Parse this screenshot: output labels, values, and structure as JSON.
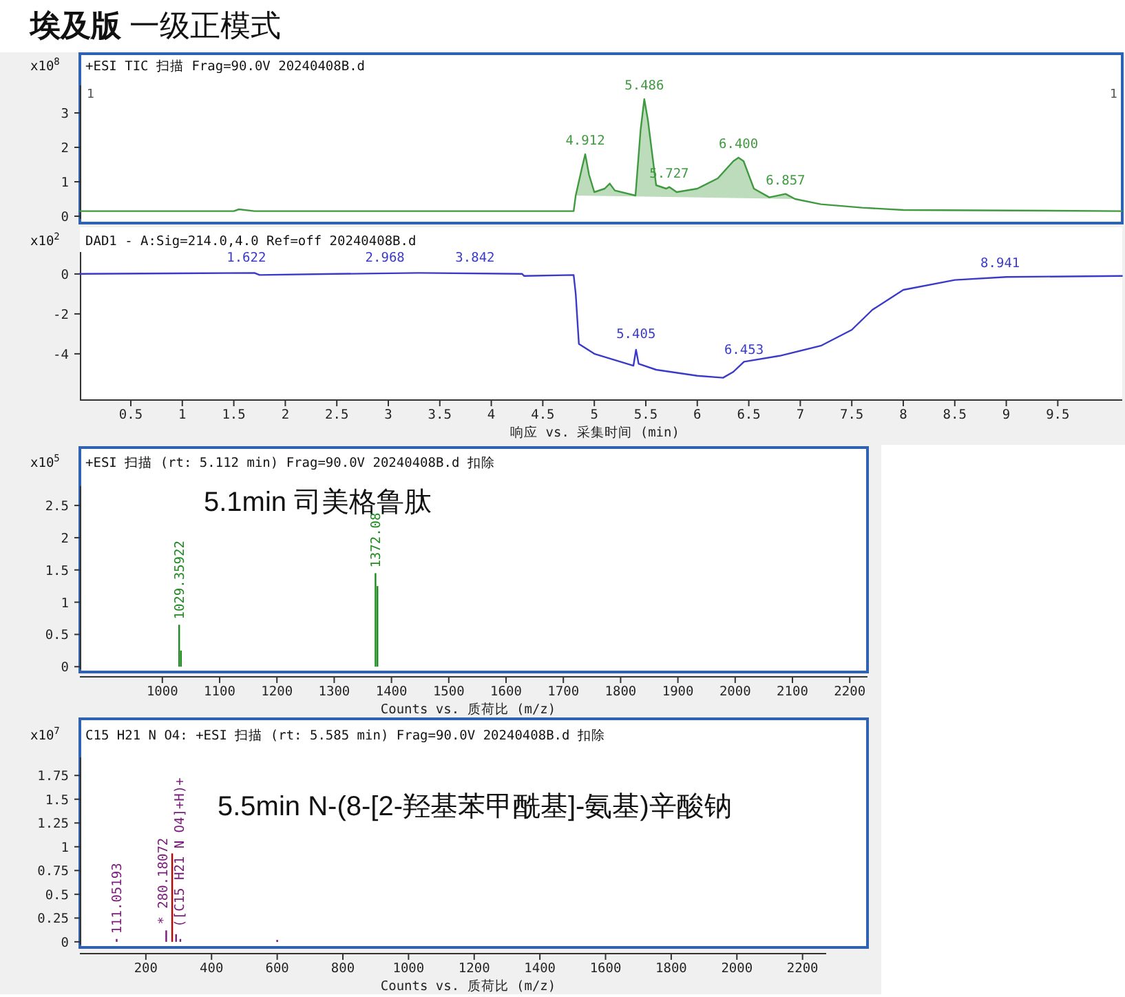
{
  "title": "**埃及版** 一级正模式",
  "panels": [
    {
      "header": "+ESI TIC 扫描 Frag=90.0V 20240408B.d",
      "scale_label": "x10$^{8}$",
      "cursor_labels": [
        "1",
        "1"
      ],
      "chart_data": {
        "type": "line",
        "xlim": [
          0,
          10.13
        ],
        "ylim": [
          -0.08,
          3.8
        ],
        "yticks": [
          0,
          1,
          2,
          3
        ],
        "x": [
          0,
          1.5,
          1.55,
          1.7,
          4.8,
          4.82,
          4.88,
          4.912,
          4.95,
          5.0,
          5.1,
          5.15,
          5.2,
          5.4,
          5.45,
          5.486,
          5.52,
          5.6,
          5.7,
          5.727,
          5.8,
          6.0,
          6.2,
          6.35,
          6.4,
          6.45,
          6.55,
          6.7,
          6.857,
          6.95,
          7.2,
          7.6,
          8.0,
          10.13
        ],
        "series": [
          {
            "color": "#3f9a3f",
            "values": [
              0.15,
              0.15,
              0.2,
              0.15,
              0.15,
              0.6,
              1.4,
              1.8,
              1.2,
              0.7,
              0.8,
              0.95,
              0.75,
              0.6,
              2.5,
              3.4,
              2.8,
              0.9,
              0.8,
              0.85,
              0.7,
              0.8,
              1.1,
              1.6,
              1.7,
              1.6,
              0.8,
              0.55,
              0.65,
              0.5,
              0.35,
              0.25,
              0.18,
              0.15
            ]
          }
        ],
        "annotations": [
          {
            "x": 4.912,
            "y": 1.8,
            "text": "4.912"
          },
          {
            "x": 5.486,
            "y": 3.4,
            "text": "5.486"
          },
          {
            "x": 5.727,
            "y": 0.85,
            "text": "5.727"
          },
          {
            "x": 6.4,
            "y": 1.7,
            "text": "6.400"
          },
          {
            "x": 6.857,
            "y": 0.65,
            "text": "6.857"
          }
        ]
      }
    },
    {
      "header": "DAD1 - A:Sig=214.0,4.0 Ref=off 20240408B.d",
      "scale_label": "x10$^{2}$",
      "chart_data": {
        "type": "line",
        "xlabel": "响应 vs. 采集时间 (min)",
        "xlim": [
          0,
          10.13
        ],
        "ylim": [
          -6.28,
          1.1
        ],
        "yticks": [
          0,
          -2,
          -4
        ],
        "xticks": [
          0.5,
          1,
          1.5,
          2,
          2.5,
          3,
          3.5,
          4,
          4.5,
          5,
          5.5,
          6,
          6.5,
          7,
          7.5,
          8,
          8.5,
          9,
          9.5
        ],
        "x": [
          0,
          1.7,
          1.75,
          2.5,
          3.3,
          4.3,
          4.32,
          4.8,
          4.82,
          4.85,
          5.0,
          5.38,
          5.405,
          5.43,
          5.6,
          6.0,
          6.25,
          6.35,
          6.453,
          6.8,
          7.2,
          7.5,
          7.7,
          8.0,
          8.5,
          9.0,
          10.13
        ],
        "series": [
          {
            "color": "#3a3ac8",
            "values": [
              0,
              0.05,
              -0.05,
              0,
              0.05,
              0,
              -0.1,
              -0.05,
              -1,
              -3.5,
              -4,
              -4.6,
              -3.8,
              -4.5,
              -4.8,
              -5.1,
              -5.2,
              -4.9,
              -4.4,
              -4.1,
              -3.6,
              -2.8,
              -1.8,
              -0.8,
              -0.3,
              -0.15,
              -0.1
            ]
          }
        ],
        "annotations": [
          {
            "x": 1.622,
            "y": 0.15,
            "text": "1.622"
          },
          {
            "x": 2.968,
            "y": 0.15,
            "text": "2.968"
          },
          {
            "x": 3.842,
            "y": 0.15,
            "text": "3.842"
          },
          {
            "x": 5.405,
            "y": -3.7,
            "text": "5.405"
          },
          {
            "x": 6.453,
            "y": -4.5,
            "text": "6.453"
          },
          {
            "x": 8.941,
            "y": -0.15,
            "text": "8.941"
          }
        ]
      }
    },
    {
      "header": "+ESI 扫描 (rt: 5.112 min) Frag=90.0V 20240408B.d 扣除",
      "scale_label": "x10$^{5}$",
      "caption": "5.1min 司美格鲁肽",
      "chart_data": {
        "type": "bar",
        "xlabel": "Counts vs. 质荷比 (m/z)",
        "xlim": [
          856,
          2231
        ],
        "ylim": [
          -0.04,
          2.8
        ],
        "yticks": [
          0,
          0.5,
          1,
          1.5,
          2,
          2.5
        ],
        "xticks": [
          1000,
          1100,
          1200,
          1300,
          1400,
          1500,
          1600,
          1700,
          1800,
          1900,
          2000,
          2100,
          2200
        ],
        "x": [
          1029.36,
          1032.5,
          1372.08,
          1375.5
        ],
        "series": [
          {
            "color": "#1f8a1f",
            "values": [
              0.65,
              0.25,
              1.45,
              1.25
            ]
          }
        ],
        "annotations": [
          {
            "x": 1029.36,
            "y": 0.67,
            "text": "1029.35922"
          },
          {
            "x": 1372.08,
            "y": 1.47,
            "text": "1372.08"
          }
        ]
      }
    },
    {
      "header": "C15 H21 N O4: +ESI 扫描 (rt: 5.585 min) Frag=90.0V 20240408B.d 扣除",
      "scale_label": "x10$^{7}$",
      "caption": "5.5min N-(8-[2-羟基苯甲酰基]-氨基)辛酸钠",
      "chart_data": {
        "type": "bar",
        "xlabel": "Counts vs. 质荷比 (m/z)",
        "xlim": [
          -1,
          2272
        ],
        "ylim": [
          -0.03,
          1.94
        ],
        "yticks": [
          0,
          0.25,
          0.5,
          0.75,
          1,
          1.25,
          1.5,
          1.75
        ],
        "xticks": [
          200,
          400,
          600,
          800,
          1000,
          1200,
          1400,
          1600,
          1800,
          2000,
          2200
        ],
        "x": [
          111.05,
          262,
          280.18,
          292,
          305,
          600
        ],
        "series": [
          {
            "color": "#7a1a7a",
            "values": [
              0.03,
              0.12,
              null,
              0.08,
              0.03,
              0.02
            ]
          },
          {
            "color": "#c00000",
            "values": [
              null,
              null,
              0.93,
              null,
              null,
              null
            ]
          }
        ],
        "annotations": [
          {
            "x": 111.05,
            "y": 0.04,
            "text": "111.05193"
          },
          {
            "x": 250,
            "y": 0.14,
            "text": "* 280.18072"
          },
          {
            "x": 300,
            "y": 0.11,
            "text": "([C15 H21 N O4]+H)+"
          }
        ]
      }
    }
  ]
}
